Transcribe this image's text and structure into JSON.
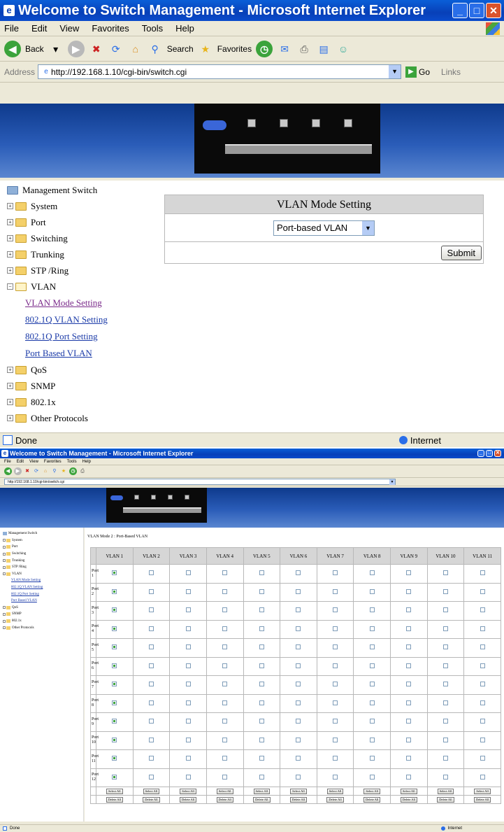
{
  "window1": {
    "title": "Welcome to Switch Management - Microsoft Internet Explorer",
    "menu": [
      "File",
      "Edit",
      "View",
      "Favorites",
      "Tools",
      "Help"
    ],
    "toolbar": {
      "back": "Back",
      "search": "Search",
      "favorites": "Favorites"
    },
    "address": {
      "label": "Address",
      "url": "http://192.168.1.10/cgi-bin/switch.cgi",
      "go": "Go",
      "links": "Links"
    },
    "sidebar": {
      "root": "Management Switch",
      "items": [
        "System",
        "Port",
        "Switching",
        "Trunking",
        "STP /Ring",
        "VLAN"
      ],
      "vlan_children": [
        "VLAN Mode Setting",
        "802.1Q VLAN Setting",
        "802.1Q Port Setting",
        "Port Based VLAN"
      ],
      "after": [
        "QoS",
        "SNMP",
        "802.1x",
        "Other Protocols"
      ]
    },
    "panel": {
      "title": "VLAN Mode Setting",
      "mode_value": "Port-based VLAN",
      "submit": "Submit"
    },
    "status": {
      "text": "Done",
      "zone": "Internet"
    }
  },
  "window2": {
    "title": "Welcome to Switch Management - Microsoft Internet Explorer",
    "mode_label": "VLAN Mode 2 : Port-Based VLAN",
    "columns": [
      "VLAN 1",
      "VLAN 2",
      "VLAN 3",
      "VLAN 4",
      "VLAN 5",
      "VLAN 6",
      "VLAN 7",
      "VLAN 8",
      "VLAN 9",
      "VLAN 10",
      "VLAN 11"
    ],
    "rows": [
      "Port 1",
      "Port 2",
      "Port 3",
      "Port 4",
      "Port 5",
      "Port 6",
      "Port 7",
      "Port 8",
      "Port 9",
      "Port 10",
      "Port 11",
      "Port 12"
    ],
    "select_all": "Select All",
    "delete_all": "Delete All",
    "status": {
      "text": "Done",
      "zone": "Internet"
    }
  }
}
